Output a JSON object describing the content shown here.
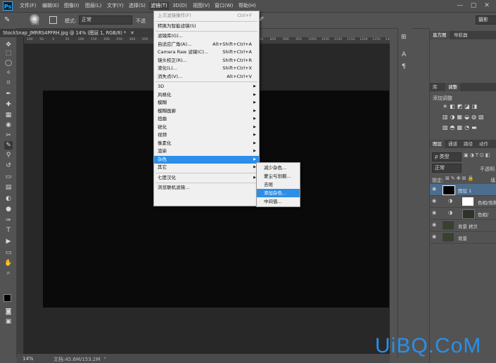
{
  "app": {
    "logo": "Ps"
  },
  "menubar": {
    "items": [
      "文件(F)",
      "编辑(E)",
      "图像(I)",
      "图层(L)",
      "文字(Y)",
      "选择(S)",
      "滤镜(T)",
      "3D(D)",
      "视图(V)",
      "窗口(W)",
      "帮助(H)"
    ],
    "active_index": 6,
    "window_controls": [
      "—",
      "▢",
      "✕"
    ]
  },
  "options_bar": {
    "brush_size": "(50)",
    "mode_label": "模式:",
    "mode_value": "正常",
    "opacity_label": "不透",
    "right_label": "摄影"
  },
  "document_tab": {
    "title": "StockSnap_JMRRS4PFRH.jpg @ 14% (图层 1, RGB/8) *",
    "close": "✕"
  },
  "ruler": {
    "ticks": [
      "100",
      "50",
      "0",
      "50",
      "100",
      "150",
      "200",
      "250",
      "300",
      "350",
      "400",
      "450",
      "500",
      "550",
      "600",
      "650",
      "700",
      "750",
      "800",
      "850",
      "900",
      "950",
      "1000",
      "1050",
      "1100",
      "1150",
      "1200",
      "1250",
      "1300"
    ]
  },
  "status_bar": {
    "zoom": "14%",
    "doc_info": "文档:45.6M/153.2M",
    "arrow": "›"
  },
  "filter_menu": {
    "items": [
      {
        "label": "上次滤镜操作(F)",
        "shortcut": "Ctrl+F",
        "disabled": true
      },
      {
        "sep": true
      },
      {
        "label": "转换为智能滤镜(S)"
      },
      {
        "sep": true
      },
      {
        "label": "滤镜库(G)..."
      },
      {
        "label": "自适应广角(A)...",
        "shortcut": "Alt+Shift+Ctrl+A"
      },
      {
        "label": "Camera Raw 滤镜(C)...",
        "shortcut": "Shift+Ctrl+A"
      },
      {
        "label": "镜头校正(R)...",
        "shortcut": "Shift+Ctrl+R"
      },
      {
        "label": "液化(L)...",
        "shortcut": "Shift+Ctrl+X"
      },
      {
        "label": "消失点(V)...",
        "shortcut": "Alt+Ctrl+V"
      },
      {
        "sep": true
      },
      {
        "label": "3D",
        "submenu": true
      },
      {
        "label": "风格化",
        "submenu": true
      },
      {
        "label": "模糊",
        "submenu": true
      },
      {
        "label": "模糊画廊",
        "submenu": true
      },
      {
        "label": "扭曲",
        "submenu": true
      },
      {
        "label": "锐化",
        "submenu": true
      },
      {
        "label": "视频",
        "submenu": true
      },
      {
        "label": "像素化",
        "submenu": true
      },
      {
        "label": "渲染",
        "submenu": true
      },
      {
        "label": "杂色",
        "submenu": true,
        "highlighted": true
      },
      {
        "label": "其它",
        "submenu": true
      },
      {
        "sep": true
      },
      {
        "label": "七度汉化",
        "submenu": true
      },
      {
        "sep": true
      },
      {
        "label": "浏览联机滤镜..."
      }
    ]
  },
  "noise_submenu": {
    "items": [
      {
        "label": "减少杂色..."
      },
      {
        "label": "蒙尘与划痕..."
      },
      {
        "label": "去斑"
      },
      {
        "label": "添加杂色...",
        "highlighted": true
      },
      {
        "label": "中间值..."
      }
    ]
  },
  "right_panel": {
    "top_tabs": [
      "直方图",
      "导航器"
    ],
    "mid_tabs": [
      "库",
      "调整"
    ],
    "adjust_label": "添加调整",
    "layer_tabs": [
      "图层",
      "通道",
      "路径",
      "动作"
    ],
    "kind_label": "ρ 类型",
    "blend_mode": "正常",
    "opacity_label": "不透明",
    "lock_label": "锁定:",
    "fill_label": "填",
    "layers": [
      {
        "name": "图层 1",
        "selected": true,
        "thumb": "#000000"
      },
      {
        "name": "色相/饱和",
        "selected": false,
        "thumb": "#ffffff"
      },
      {
        "name": "色相/",
        "selected": false,
        "thumb": "#2d3328"
      },
      {
        "name": "背景 拷贝",
        "selected": false,
        "thumb": "#3a4030"
      },
      {
        "name": "背景",
        "selected": false,
        "thumb": "#3a4030"
      }
    ]
  },
  "watermark": {
    "text": "UiBQ.CoM"
  }
}
